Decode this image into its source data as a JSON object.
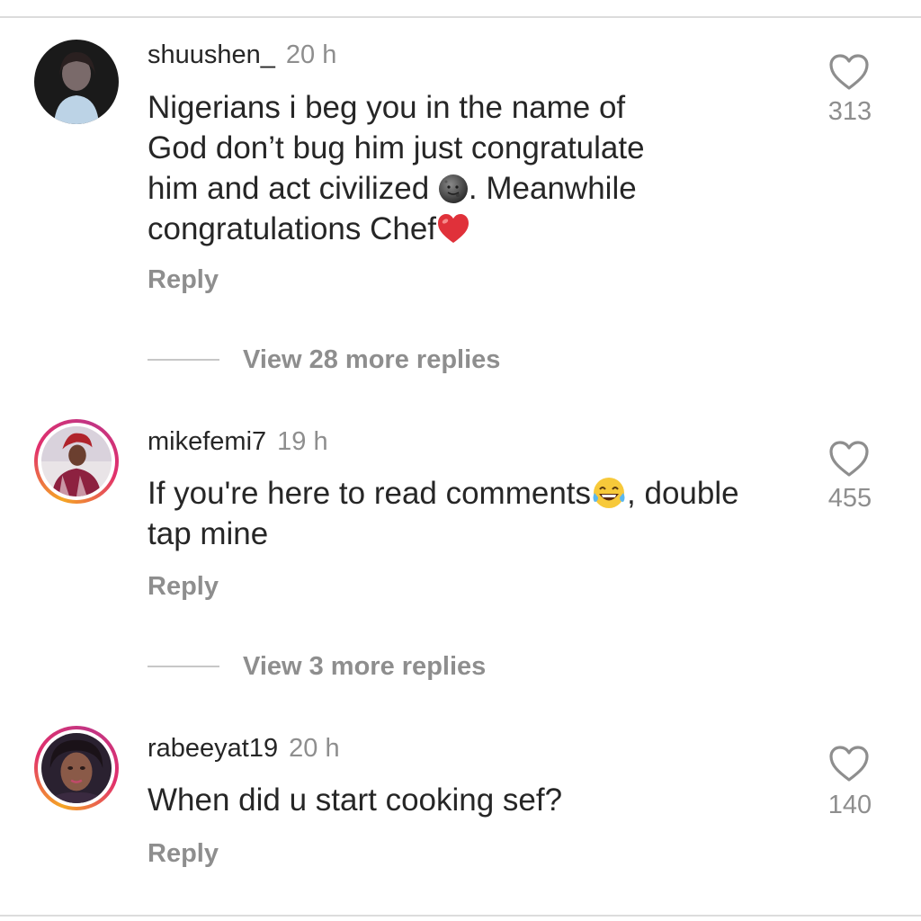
{
  "comments": [
    {
      "username": "shuushen_",
      "time": "20 h",
      "text_lines": [
        "Nigerians i beg you in the name of",
        "God don’t bug him just congratulate",
        "him and act civilized ",
        ". Meanwhile",
        "congratulations Chef"
      ],
      "reply_label": "Reply",
      "likes": "313",
      "emojis": [
        "new-moon-face-icon",
        "red-heart-icon"
      ]
    },
    {
      "username": "mikefemi7",
      "time": "19 h",
      "text_lines": [
        "If you're here to read comments",
        ", double",
        "tap mine"
      ],
      "reply_label": "Reply",
      "likes": "455",
      "emojis": [
        "tears-of-joy-icon"
      ]
    },
    {
      "username": "rabeeyat19",
      "time": "20 h",
      "text_lines": [
        "When did u start cooking sef?"
      ],
      "reply_label": "Reply",
      "likes": "140"
    }
  ],
  "view_more": [
    {
      "label": "View 28 more replies"
    },
    {
      "label": "View 3 more replies"
    }
  ],
  "colors": {
    "text": "#262626",
    "muted": "#8e8e8e",
    "divider": "#dcdcdc",
    "heart": "#e0313a"
  }
}
